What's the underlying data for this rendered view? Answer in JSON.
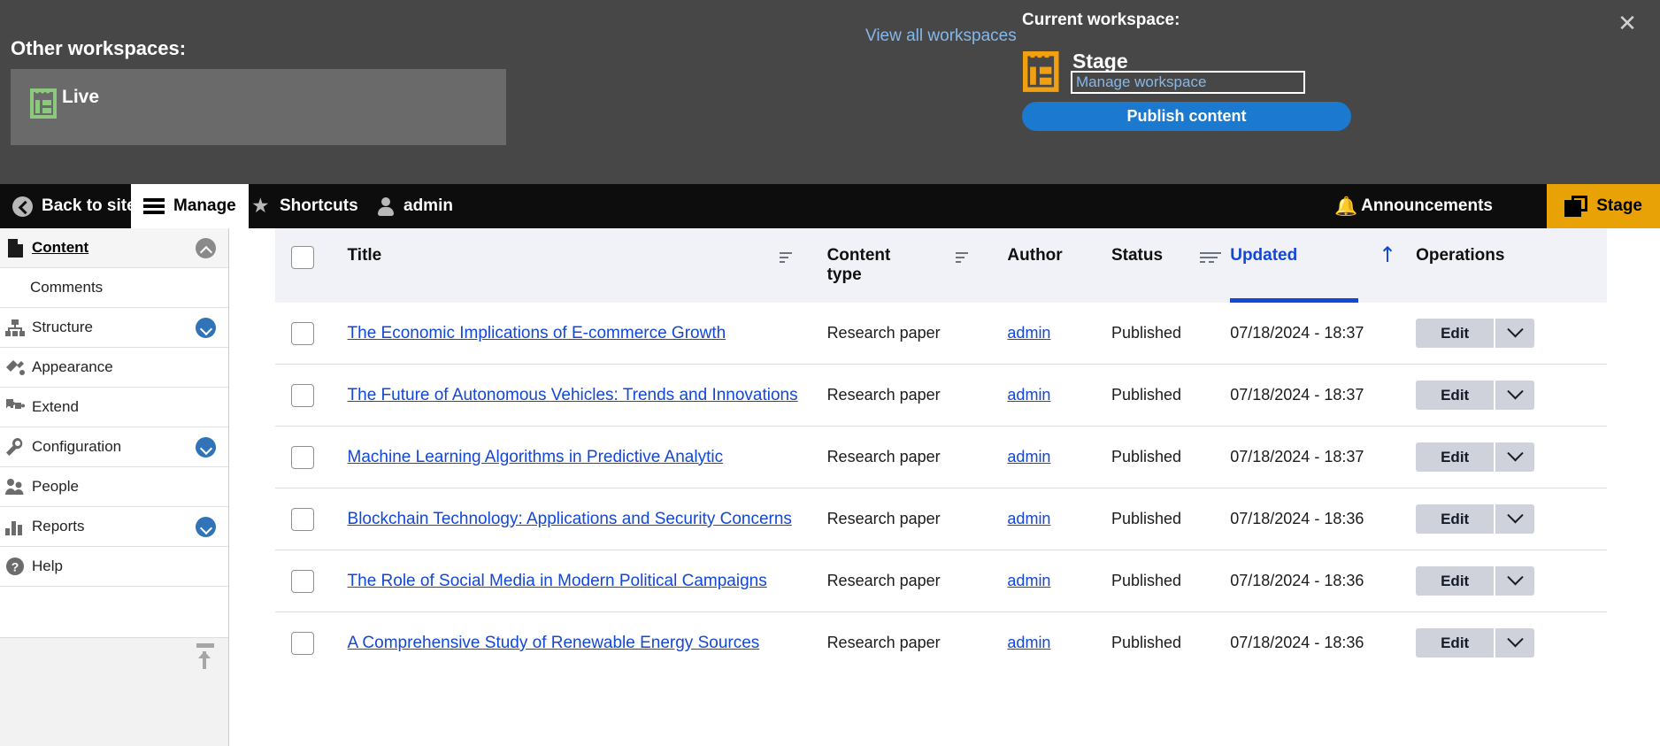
{
  "workspace_panel": {
    "other_label": "Other workspaces:",
    "other_items": [
      {
        "name": "Live",
        "icon": "workspace-icon",
        "color": "#8cc97e"
      }
    ],
    "view_all_link": "View all workspaces",
    "current_label": "Current workspace:",
    "current_name": "Stage",
    "current_icon_color": "#f0a010",
    "manage_link": "Manage workspace",
    "publish_button": "Publish content",
    "close_icon": "close-icon",
    "accent_blue": "#1b79d0",
    "link_blue": "#85b8e8",
    "panel_bg": "#474747",
    "card_bg": "#6a6a6a"
  },
  "toolbar": {
    "back_to_site": "Back to site",
    "manage": "Manage",
    "shortcuts": "Shortcuts",
    "user": "admin",
    "announcements": "Announcements",
    "stage": "Stage",
    "stage_bg": "#e8a206",
    "bar_bg": "#0d0d0d"
  },
  "sidebar": {
    "items": [
      {
        "label": "Content",
        "icon": "document-icon",
        "toggle": "chevron-up-icon",
        "active": true,
        "sub": false
      },
      {
        "label": "Comments",
        "icon": "none",
        "toggle": "none",
        "active": false,
        "sub": true
      },
      {
        "label": "Structure",
        "icon": "structure-icon",
        "toggle": "chevron-down-icon",
        "active": false,
        "sub": false
      },
      {
        "label": "Appearance",
        "icon": "brush-icon",
        "toggle": "none",
        "active": false,
        "sub": false
      },
      {
        "label": "Extend",
        "icon": "puzzle-icon",
        "toggle": "none",
        "active": false,
        "sub": false
      },
      {
        "label": "Configuration",
        "icon": "wrench-icon",
        "toggle": "chevron-down-icon",
        "active": false,
        "sub": false
      },
      {
        "label": "People",
        "icon": "people-icon",
        "toggle": "none",
        "active": false,
        "sub": false
      },
      {
        "label": "Reports",
        "icon": "bar-chart-icon",
        "toggle": "chevron-down-icon",
        "active": false,
        "sub": false
      },
      {
        "label": "Help",
        "icon": "question-icon",
        "toggle": "none",
        "active": false,
        "sub": false
      }
    ],
    "collapse_icon": "collapse-sidebar-icon"
  },
  "table": {
    "columns": [
      {
        "key": "check",
        "label": "",
        "sort_icon": false,
        "active": false
      },
      {
        "key": "title",
        "label": "Title",
        "sort_icon": true,
        "active": false
      },
      {
        "key": "type",
        "label": "Content type",
        "sort_icon": true,
        "active": false
      },
      {
        "key": "author",
        "label": "Author",
        "sort_icon": false,
        "active": false
      },
      {
        "key": "status",
        "label": "Status",
        "sort_icon": true,
        "active": false
      },
      {
        "key": "updated",
        "label": "Updated",
        "sort_icon": true,
        "active": true
      },
      {
        "key": "ops",
        "label": "Operations",
        "sort_icon": false,
        "active": false
      }
    ],
    "sort_direction_icon": "arrow-up-icon",
    "active_sort_color": "#1347d6",
    "edit_label": "Edit",
    "rows": [
      {
        "title": "The Economic Implications of E-commerce Growth",
        "type": "Research paper",
        "author": "admin",
        "status": "Published",
        "updated": "07/18/2024 - 18:37"
      },
      {
        "title": "The Future of Autonomous Vehicles: Trends and Innovations",
        "type": "Research paper",
        "author": "admin",
        "status": "Published",
        "updated": "07/18/2024 - 18:37"
      },
      {
        "title": "Machine Learning Algorithms in Predictive Analytic",
        "type": "Research paper",
        "author": "admin",
        "status": "Published",
        "updated": "07/18/2024 - 18:37"
      },
      {
        "title": "Blockchain Technology: Applications and Security Concerns",
        "type": "Research paper",
        "author": "admin",
        "status": "Published",
        "updated": "07/18/2024 - 18:36"
      },
      {
        "title": "The Role of Social Media in Modern Political Campaigns",
        "type": "Research paper",
        "author": "admin",
        "status": "Published",
        "updated": "07/18/2024 - 18:36"
      },
      {
        "title": "A Comprehensive Study of Renewable Energy Sources",
        "type": "Research paper",
        "author": "admin",
        "status": "Published",
        "updated": "07/18/2024 - 18:36"
      }
    ]
  }
}
